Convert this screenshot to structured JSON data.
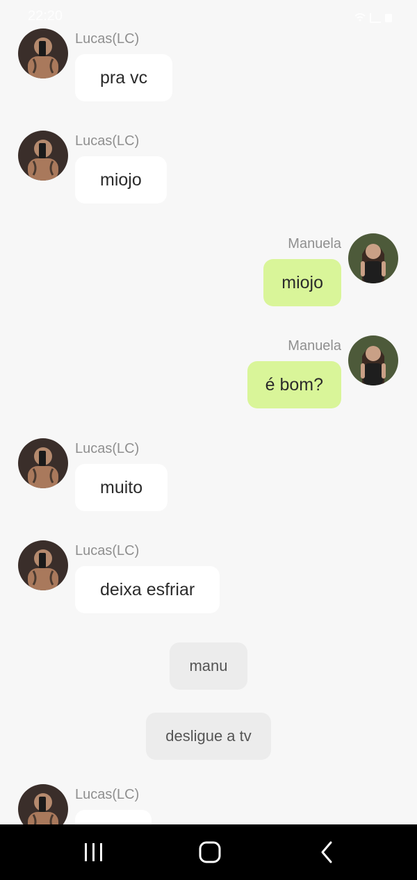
{
  "status_bar": {
    "time": "22:20"
  },
  "messages": [
    {
      "type": "incoming",
      "name": "Lucas(LC)",
      "text": "pra vc"
    },
    {
      "type": "incoming",
      "name": "Lucas(LC)",
      "text": "miojo"
    },
    {
      "type": "outgoing",
      "name": "Manuela",
      "text": "miojo"
    },
    {
      "type": "outgoing",
      "name": "Manuela",
      "text": "é bom?"
    },
    {
      "type": "incoming",
      "name": "Lucas(LC)",
      "text": "muito"
    },
    {
      "type": "incoming",
      "name": "Lucas(LC)",
      "text": "deixa esfriar"
    },
    {
      "type": "system",
      "text": "manu"
    },
    {
      "type": "system",
      "text": "desligue a tv"
    },
    {
      "type": "incoming",
      "name": "Lucas(LC)",
      "text": ""
    }
  ],
  "nav": {
    "recent": "recent-apps-icon",
    "home": "home-icon",
    "back": "back-icon"
  },
  "colors": {
    "background": "#f7f7f7",
    "incoming_bubble": "#ffffff",
    "outgoing_bubble": "#d9f599",
    "system_pill": "#ececec",
    "name_text": "#8f8f8f"
  }
}
